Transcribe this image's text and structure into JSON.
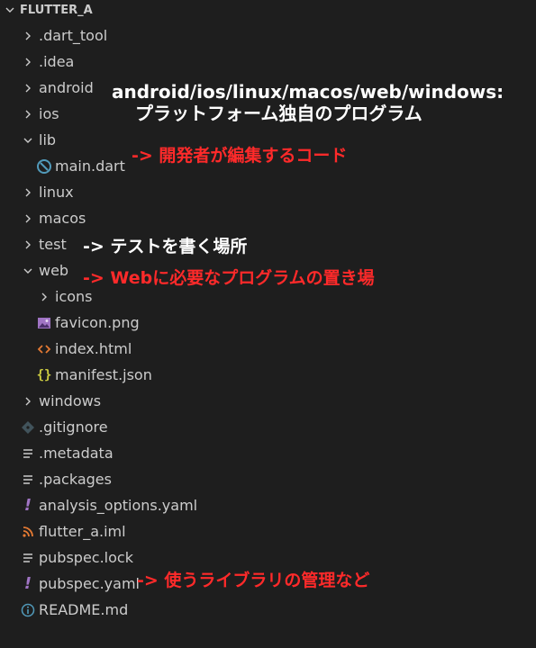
{
  "explorer": {
    "root_label": "FLUTTER_A",
    "items": [
      {
        "label": ".dart_tool",
        "type": "folder",
        "expanded": false
      },
      {
        "label": ".idea",
        "type": "folder",
        "expanded": false
      },
      {
        "label": "android",
        "type": "folder",
        "expanded": false
      },
      {
        "label": "ios",
        "type": "folder",
        "expanded": false
      },
      {
        "label": "lib",
        "type": "folder",
        "expanded": true
      },
      {
        "label": "main.dart",
        "type": "dart-file"
      },
      {
        "label": "linux",
        "type": "folder",
        "expanded": false
      },
      {
        "label": "macos",
        "type": "folder",
        "expanded": false
      },
      {
        "label": "test",
        "type": "folder",
        "expanded": false
      },
      {
        "label": "web",
        "type": "folder",
        "expanded": true
      },
      {
        "label": "icons",
        "type": "folder",
        "expanded": false
      },
      {
        "label": "favicon.png",
        "type": "image-file"
      },
      {
        "label": "index.html",
        "type": "html-file"
      },
      {
        "label": "manifest.json",
        "type": "json-file"
      },
      {
        "label": "windows",
        "type": "folder",
        "expanded": false
      },
      {
        "label": ".gitignore",
        "type": "git-file"
      },
      {
        "label": ".metadata",
        "type": "text-file"
      },
      {
        "label": ".packages",
        "type": "text-file"
      },
      {
        "label": "analysis_options.yaml",
        "type": "yaml-file"
      },
      {
        "label": "flutter_a.iml",
        "type": "rss-file"
      },
      {
        "label": "pubspec.lock",
        "type": "text-file"
      },
      {
        "label": "pubspec.yaml",
        "type": "yaml-file"
      },
      {
        "label": "README.md",
        "type": "info-file"
      }
    ]
  },
  "annotations": {
    "platform_line1": "android/ios/linux/macos/web/windows:",
    "platform_line2": "プラットフォーム独自のプログラム",
    "lib_note": "-> 開発者が編集するコード",
    "test_note": "-> テストを書く場所",
    "web_note": "-> Webに必要なプログラムの置き場",
    "pubspec_note": "-> 使うライブラリの管理など"
  },
  "colors": {
    "background": "#1e1e1e",
    "text": "#cccccc",
    "annotation_red": "#ff2a2a",
    "annotation_white": "#ffffff",
    "dart_icon": "#519aba",
    "image_icon": "#a074c4",
    "html_icon": "#e37933",
    "json_icon": "#cbcb41",
    "yaml_icon": "#a074c4",
    "rss_icon": "#e37933",
    "info_icon": "#519aba",
    "git_icon": "#41535b"
  }
}
